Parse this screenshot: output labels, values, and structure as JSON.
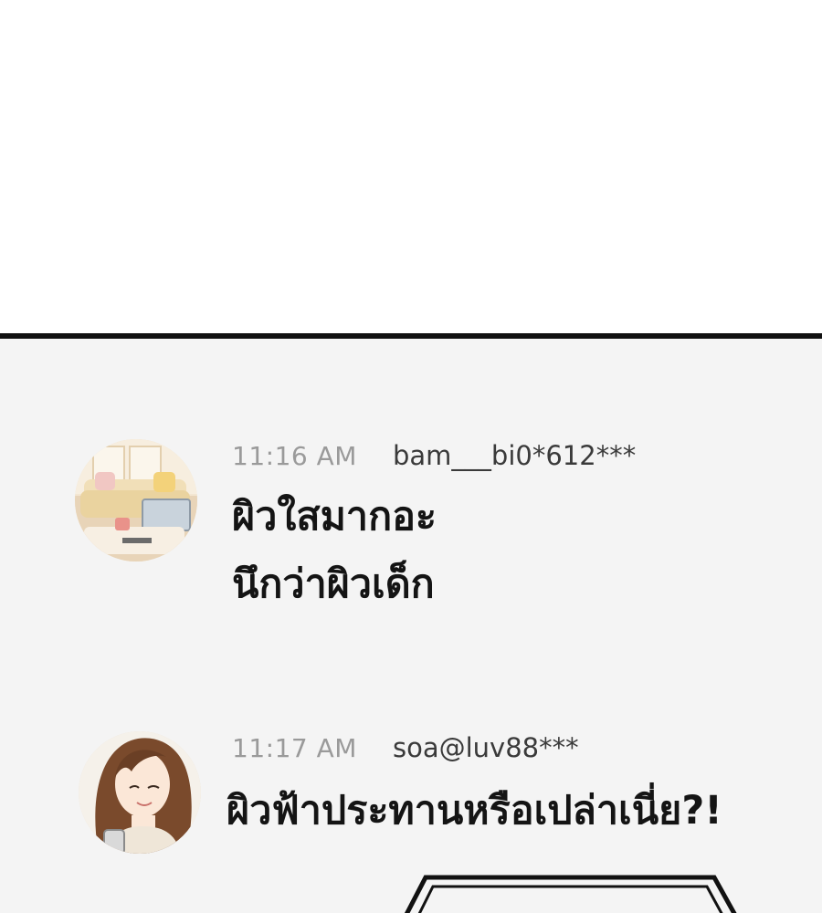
{
  "comments": [
    {
      "time": "11:16  AM",
      "username": "bam___bi0*612***",
      "lines": [
        "ผิวใสมากอะ",
        "นึกว่าผิวเด็ก"
      ],
      "avatar": "living-room-avatar"
    },
    {
      "time": "11:17  AM",
      "username": "soa@luv88***",
      "lines": [
        "ผิวฟ้าประทานหรือเปล่าเนี่ย?!"
      ],
      "avatar": "woman-portrait-avatar"
    }
  ],
  "colors": {
    "background_top": "#ffffff",
    "feed_background": "#f4f4f4",
    "divider": "#111111",
    "time_text": "#9a9a9a",
    "username_text": "#3a3a3a",
    "message_text": "#141414"
  }
}
